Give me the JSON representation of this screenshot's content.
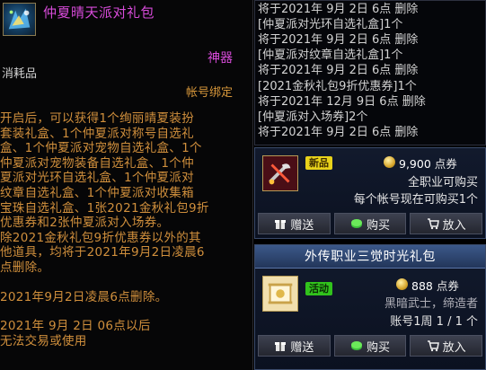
{
  "tooltip": {
    "title": "仲夏晴天派对礼包",
    "rarity": "神器",
    "type": "消耗品",
    "bind": "帐号绑定",
    "desc_lines": [
      "开启后，可以获得1个绚丽晴夏装扮",
      "套装礼盒、1个仲夏派对称号自选礼",
      "盒、1个仲夏派对宠物自选礼盒、1个",
      "仲夏派对宠物装备自选礼盒、1个仲",
      "夏派对光环自选礼盒、1个仲夏派对",
      "纹章自选礼盒、1个仲夏派对收集箱",
      "宝珠自选礼盒、1张2021金秋礼包9折",
      "优惠券和2张仲夏派对入场券。",
      "除2021金秋礼包9折优惠券以外的其",
      "他道具，均将于2021年9月2日凌晨6",
      "点删除。",
      "",
      "2021年9月2日凌晨6点删除。",
      "",
      "2021年 9月 2日 06点以后",
      "无法交易或使用"
    ]
  },
  "log": {
    "lines": [
      "将于2021年 9月 2日 6点 删除",
      "[仲夏派对光环自选礼盒]1个",
      "将于2021年 9月 2日 6点 删除",
      "[仲夏派对纹章自选礼盒]1个",
      "将于2021年 9月 2日 6点 删除",
      "[2021金秋礼包9折优惠券]1个",
      "将于2021年 12月 9日 6点 删除",
      "[仲夏派对入场券]2个",
      "将于2021年 9月 2日 6点 删除"
    ]
  },
  "card1": {
    "badge": "新品",
    "price": "9,900",
    "price_unit": "点券",
    "line1": "全职业可购买",
    "line2": "每个帐号现在可购买1个",
    "btn_gift": "赠送",
    "btn_buy": "购买",
    "btn_cart": "放入"
  },
  "card2": {
    "title": "外传职业三觉时光礼包",
    "badge": "活动",
    "price": "888",
    "price_unit": "点券",
    "line1": "黑暗武士，缔造者",
    "line2": "账号1周 1 / 1 个",
    "btn_gift": "赠送",
    "btn_buy": "购买",
    "btn_cart": "放入"
  },
  "colors": {
    "title_purple": "#d74bd9",
    "desc_orange": "#d08f3c",
    "new_badge": "#e8d21a",
    "event_badge": "#31c21c",
    "header_blue": "#3b5889"
  },
  "icons": [
    "party-gift-icon",
    "wrench-weapon-icon",
    "gold-scroll-icon",
    "coin-icon",
    "gift-icon",
    "cash-icon",
    "cart-icon"
  ]
}
